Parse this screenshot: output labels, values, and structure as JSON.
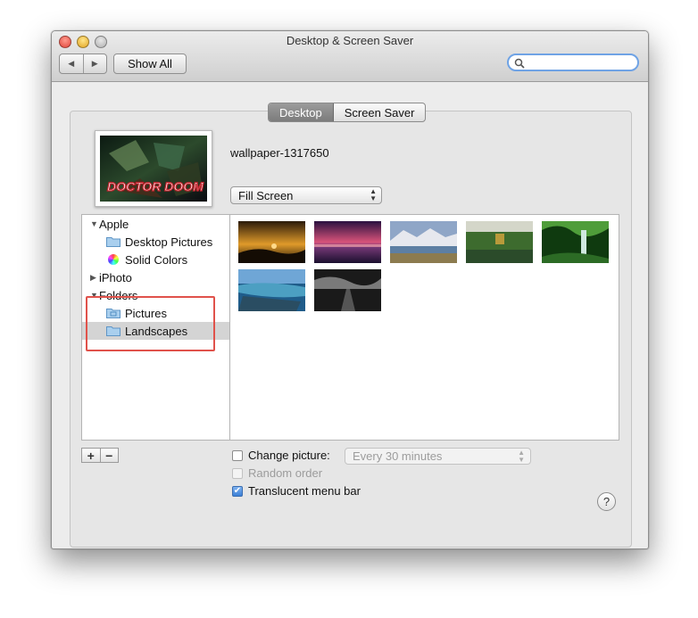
{
  "window": {
    "title": "Desktop & Screen Saver"
  },
  "toolbar": {
    "back_icon": "◀",
    "forward_icon": "▶",
    "show_all_label": "Show All",
    "search_placeholder": ""
  },
  "tabs": [
    {
      "label": "Desktop",
      "active": true
    },
    {
      "label": "Screen Saver",
      "active": false
    }
  ],
  "current_wallpaper": {
    "name": "wallpaper-1317650",
    "preview_text": "DOCTOR DOOM"
  },
  "fit_popup": {
    "value": "Fill Screen"
  },
  "sidebar": {
    "items": [
      {
        "label": "Apple",
        "level": 0,
        "expanded": true
      },
      {
        "label": "Desktop Pictures",
        "level": 1,
        "icon": "folder-icon"
      },
      {
        "label": "Solid Colors",
        "level": 1,
        "icon": "color-wheel-icon"
      },
      {
        "label": "iPhoto",
        "level": 0,
        "expanded": false
      },
      {
        "label": "Folders",
        "level": 0,
        "expanded": true
      },
      {
        "label": "Pictures",
        "level": 1,
        "icon": "folder-icon"
      },
      {
        "label": "Landscapes",
        "level": 1,
        "icon": "folder-icon",
        "selected": true
      }
    ]
  },
  "thumbnails": [
    {
      "name": "sunset-silhouette",
      "colors": [
        "#1c1206",
        "#e09a2a"
      ]
    },
    {
      "name": "pink-sky-lake",
      "colors": [
        "#2a1140",
        "#d8537a"
      ]
    },
    {
      "name": "mountain-lake",
      "colors": [
        "#8fa6c7",
        "#8c7b4f"
      ]
    },
    {
      "name": "asian-pavilion",
      "colors": [
        "#3d6b2e",
        "#d4d6c9"
      ]
    },
    {
      "name": "jungle-waterfall",
      "colors": [
        "#0f3a0f",
        "#4f9d3a"
      ]
    },
    {
      "name": "island-lagoon",
      "colors": [
        "#1f5c8a",
        "#4c9fc2"
      ]
    },
    {
      "name": "dark-clouds-road",
      "colors": [
        "#1a1a1a",
        "#7a7a7a"
      ]
    }
  ],
  "list_buttons": {
    "add": "+",
    "remove": "−"
  },
  "options": {
    "change_picture": {
      "label": "Change picture:",
      "checked": false
    },
    "interval": {
      "value": "Every 30 minutes"
    },
    "random_order": {
      "label": "Random order",
      "checked": false,
      "enabled": false
    },
    "translucent_menu_bar": {
      "label": "Translucent menu bar",
      "checked": true
    }
  },
  "help_button": "?",
  "colors": {
    "highlight": "#e0524b",
    "accent": "#6fa3e5"
  }
}
